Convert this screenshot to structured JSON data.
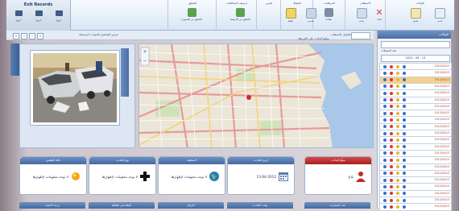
{
  "exit_panel": {
    "title": "Exit Records",
    "buttons": [
      {
        "label": "خروج"
      },
      {
        "label": "خروج"
      },
      {
        "label": "خروج"
      }
    ]
  },
  "ribbon": {
    "groups": [
      "البيانات",
      "الاستعلام",
      "المرفقات",
      "الحفظ",
      "تقارير",
      "ارشيف المخالفات",
      "التحقق"
    ],
    "buttons": [
      {
        "label": "جديد",
        "icon": "new-doc-icon",
        "color": "#e8eef7"
      },
      {
        "label": "تعديل",
        "icon": "edit-icon",
        "color": "#f2e7b0"
      },
      {
        "label": "حذف",
        "icon": "delete-icon",
        "color": "#d93a3a"
      },
      {
        "label": "بحث",
        "icon": "search-icon",
        "color": "#cfdcec"
      },
      {
        "label": "طباعة",
        "icon": "printer-icon",
        "color": "#7d8da3"
      },
      {
        "label": "تصدير",
        "icon": "export-icon",
        "color": "#c9d6e6"
      },
      {
        "label": "حفظ",
        "icon": "save-icon",
        "color": "#f0d36a"
      },
      {
        "label": "التحقق من الارشيف",
        "icon": "check-icon",
        "color": "#5aa34a"
      },
      {
        "label": "التحقق من المصورة",
        "icon": "verify-icon",
        "color": "#5aa34a"
      }
    ]
  },
  "toolbar": {
    "nav_path": "عرض التفاصيل للحوادث المسجلة",
    "title": "تفاصيل الاستعلام"
  },
  "map_title": "موقع الحادث على الخريطة",
  "right_panel": {
    "header": "البيانات",
    "info": "عدد السجلات",
    "date_range": "2012 - 04 - 13",
    "rows": [
      {
        "date": "2012/04/13",
        "selected": false
      },
      {
        "date": "2012/04/13",
        "selected": false
      },
      {
        "date": "2012/04/13",
        "selected": true
      },
      {
        "date": "2012/04/13",
        "selected": false
      },
      {
        "date": "2012/04/13",
        "selected": false
      },
      {
        "date": "2012/04/13",
        "selected": false
      },
      {
        "date": "2012/04/13",
        "selected": false
      },
      {
        "date": "2012/04/13",
        "selected": false
      },
      {
        "date": "2012/04/13",
        "selected": false
      },
      {
        "date": "2012/04/13",
        "selected": false
      },
      {
        "date": "2012/04/13",
        "selected": false
      },
      {
        "date": "2012/04/13",
        "selected": false
      },
      {
        "date": "2012/04/13",
        "selected": false
      },
      {
        "date": "2012/04/13",
        "selected": false
      },
      {
        "date": "2012/04/13",
        "selected": false
      },
      {
        "date": "2012/04/13",
        "selected": false
      },
      {
        "date": "2012/04/13",
        "selected": false
      },
      {
        "date": "2012/04/13",
        "selected": false
      },
      {
        "date": "2012/04/13",
        "selected": false
      },
      {
        "date": "2012/04/13",
        "selected": false
      },
      {
        "date": "2012/04/13",
        "selected": false
      },
      {
        "date": "2012/04/13",
        "selected": false
      }
    ]
  },
  "cards": [
    {
      "header": "حالة الطقس",
      "value": "لا توجد معلومات لإظهارها",
      "icon": "sun-icon",
      "red": false
    },
    {
      "header": "نوع الحادث",
      "value": "لا توجد معلومات لإظهارها",
      "icon": "cross-icon",
      "red": false
    },
    {
      "header": "المنطقة",
      "value": "لا توجد معلومات لإظهارها",
      "icon": "globe-icon",
      "red": false
    },
    {
      "header": "تاريخ الحادث",
      "value": "13-04-2012",
      "icon": "calendar-icon",
      "red": false
    },
    {
      "header": "مبلّغ الحادث",
      "value": "بلاغ",
      "icon": "person-icon",
      "red": true
    }
  ],
  "bottom_labels": [
    "درجة الاصابة",
    "الحالة في الطاقة",
    "الارقام",
    "وقت الحادث",
    "عدد السيارات"
  ],
  "colors": {
    "accent": "#44699f",
    "alert": "#c0312f",
    "selected_row": "#f6d18b"
  }
}
